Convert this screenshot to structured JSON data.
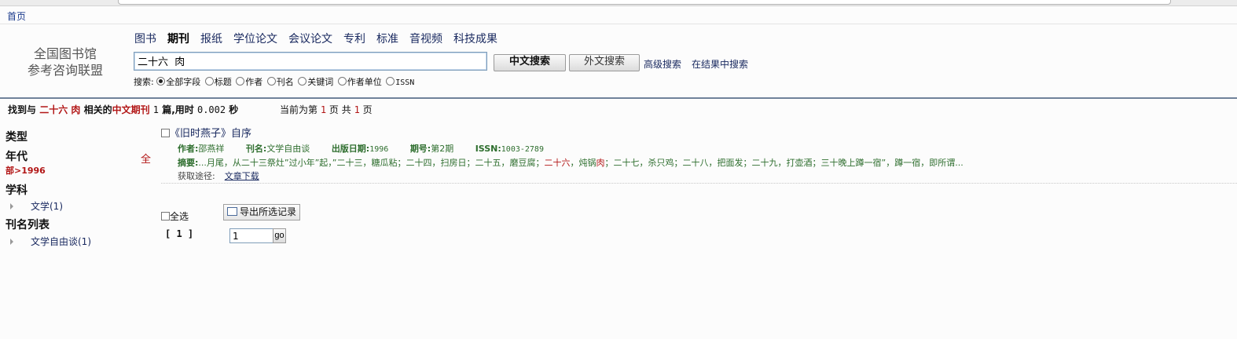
{
  "breadcrumb": {
    "home": "首页"
  },
  "logo": {
    "line1": "全国图书馆",
    "line2": "参考咨询联盟"
  },
  "nav": {
    "items": [
      "图书",
      "期刊",
      "报纸",
      "学位论文",
      "会议论文",
      "专利",
      "标准",
      "音视频",
      "科技成果"
    ],
    "active": "期刊"
  },
  "search": {
    "query": "二十六  肉",
    "chinese_button": "中文搜索",
    "foreign_button": "外文搜索",
    "advanced_link": "高级搜索",
    "within_results_link": "在结果中搜索"
  },
  "scope": {
    "label": "搜索:",
    "options": [
      "全部字段",
      "标题",
      "作者",
      "刊名",
      "关键词",
      "作者单位",
      "ISSN"
    ],
    "selected": "全部字段"
  },
  "result_info": {
    "prefix": "找到与",
    "query": "二十六 肉",
    "related": "相关的",
    "category": "中文期刊",
    "count": "1",
    "count_suffix": "篇,用时",
    "time": "0.002",
    "time_suffix": "秒"
  },
  "page_info": {
    "current_prefix": "当前为第",
    "current": "1",
    "total_prefix": "页 共",
    "total": "1",
    "total_suffix": "页"
  },
  "facets": {
    "type_heading": "类型",
    "year_heading": "年代",
    "year_all": "全",
    "year_value": "部>1996",
    "subject_heading": "学科",
    "subject_item": "文学(1)",
    "journal_heading": "刊名列表",
    "journal_item": "文学自由谈(1)"
  },
  "record": {
    "title": "《旧时燕子》自序",
    "author_label": "作者:",
    "author": "邵燕祥",
    "journal_label": "刊名:",
    "journal": "文学自由谈",
    "date_label": "出版日期:",
    "date": "1996",
    "issue_label": "期号:",
    "issue": "第2期",
    "issn_label": "ISSN:",
    "issn": "1003-2789",
    "abstract_label": "摘要:",
    "abstract_before": "...月尾，从二十三祭灶”过小年”起，”二十三，糖瓜粘；二十四，扫房日；二十五，磨豆腐；",
    "abstract_key1": "二十六",
    "abstract_mid": "，炖锅",
    "abstract_key2": "肉",
    "abstract_after": "；二十七，杀只鸡；二十八，把面发；二十九，打壶酒；三十晚上蹲一宿”，蹲一宿，即所谓...",
    "access_label": "获取途径:",
    "download_link": "文章下载"
  },
  "footer_controls": {
    "select_all": "全选",
    "export_button": "导出所选记录",
    "pager": "[  1  ]",
    "page_input": "1",
    "go_button": "go"
  }
}
